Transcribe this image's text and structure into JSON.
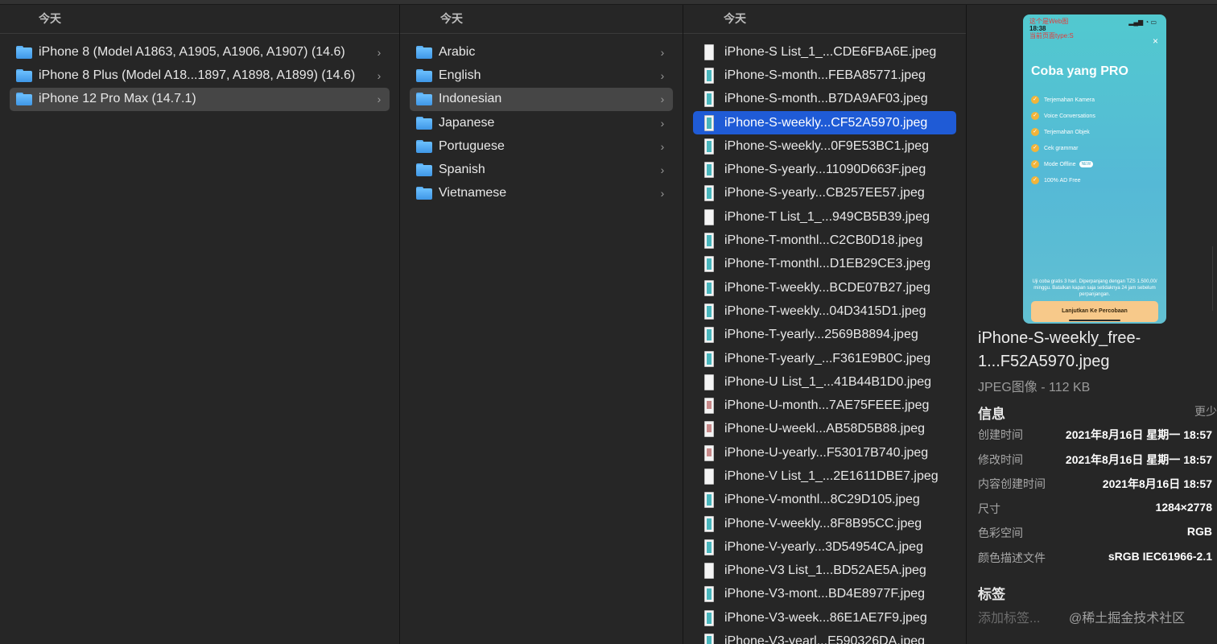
{
  "columns": {
    "col1": {
      "header": "今天",
      "items": [
        {
          "label": "iPhone 8 (Model A1863, A1905, A1906, A1907) (14.6)",
          "selected": false
        },
        {
          "label": "iPhone 8 Plus (Model A18...1897, A1898, A1899) (14.6)",
          "selected": false
        },
        {
          "label": "iPhone 12 Pro Max (14.7.1)",
          "selected": true
        }
      ]
    },
    "col2": {
      "header": "今天",
      "items": [
        {
          "label": "Arabic"
        },
        {
          "label": "English"
        },
        {
          "label": "Indonesian",
          "selected": true
        },
        {
          "label": "Japanese"
        },
        {
          "label": "Portuguese"
        },
        {
          "label": "Spanish"
        },
        {
          "label": "Vietnamese"
        }
      ]
    },
    "col3": {
      "header": "今天",
      "items": [
        {
          "label": "iPhone-S List_1_...CDE6FBA6E.jpeg",
          "thumb": "white"
        },
        {
          "label": "iPhone-S-month...FEBA85771.jpeg",
          "thumb": "teal"
        },
        {
          "label": "iPhone-S-month...B7DA9AF03.jpeg",
          "thumb": "teal"
        },
        {
          "label": "iPhone-S-weekly...CF52A5970.jpeg",
          "thumb": "teal",
          "selected": true
        },
        {
          "label": "iPhone-S-weekly...0F9E53BC1.jpeg",
          "thumb": "teal"
        },
        {
          "label": "iPhone-S-yearly...11090D663F.jpeg",
          "thumb": "teal"
        },
        {
          "label": "iPhone-S-yearly...CB257EE57.jpeg",
          "thumb": "teal"
        },
        {
          "label": "iPhone-T List_1_...949CB5B39.jpeg",
          "thumb": "white"
        },
        {
          "label": "iPhone-T-monthl...C2CB0D18.jpeg",
          "thumb": "teal"
        },
        {
          "label": "iPhone-T-monthl...D1EB29CE3.jpeg",
          "thumb": "teal"
        },
        {
          "label": "iPhone-T-weekly...BCDE07B27.jpeg",
          "thumb": "teal"
        },
        {
          "label": "iPhone-T-weekly...04D3415D1.jpeg",
          "thumb": "teal"
        },
        {
          "label": "iPhone-T-yearly...2569B8894.jpeg",
          "thumb": "teal"
        },
        {
          "label": "iPhone-T-yearly_...F361E9B0C.jpeg",
          "thumb": "teal"
        },
        {
          "label": "iPhone-U List_1_...41B44B1D0.jpeg",
          "thumb": "white"
        },
        {
          "label": "iPhone-U-month...7AE75FEEE.jpeg",
          "thumb": "mixed"
        },
        {
          "label": "iPhone-U-weekl...AB58D5B88.jpeg",
          "thumb": "mixed"
        },
        {
          "label": "iPhone-U-yearly...F53017B740.jpeg",
          "thumb": "mixed"
        },
        {
          "label": "iPhone-V List_1_...2E1611DBE7.jpeg",
          "thumb": "white"
        },
        {
          "label": "iPhone-V-monthl...8C29D105.jpeg",
          "thumb": "teal"
        },
        {
          "label": "iPhone-V-weekly...8F8B95CC.jpeg",
          "thumb": "teal"
        },
        {
          "label": "iPhone-V-yearly...3D54954CA.jpeg",
          "thumb": "teal"
        },
        {
          "label": "iPhone-V3 List_1...BD52AE5A.jpeg",
          "thumb": "white"
        },
        {
          "label": "iPhone-V3-mont...BD4E8977F.jpeg",
          "thumb": "teal"
        },
        {
          "label": "iPhone-V3-week...86E1AE7F9.jpeg",
          "thumb": "teal"
        },
        {
          "label": "iPhone-V3-yearl...E590326DA.jpeg",
          "thumb": "teal"
        }
      ]
    }
  },
  "preview": {
    "phone": {
      "status_line1": "这个是Web图",
      "time": "18:38",
      "status_line2": "当前页面type:S",
      "title": "Coba yang PRO",
      "features": [
        "Terjemahan Kamera",
        "Voice Conversations",
        "Terjemahan Objek",
        "Cek grammar",
        "Mode Offline",
        "100% AD Free"
      ],
      "new_badge": "NEW",
      "fine_print": "Uji coba gratis 3 hari. Diperpanjang dengan TZS 1.500,00/ minggu. Batalkan kapan saja setidaknya 24 jam sebelum perpanjangan.",
      "cta": "Lanjutkan Ke Percobaan",
      "close": "×"
    },
    "filename": "iPhone-S-weekly_free-1...F52A5970.jpeg",
    "filetype": "JPEG图像 - 112 KB",
    "info_title": "信息",
    "show_less": "更少",
    "info": [
      {
        "key": "创建时间",
        "value": "2021年8月16日 星期一 18:57"
      },
      {
        "key": "修改时间",
        "value": "2021年8月16日 星期一 18:57"
      },
      {
        "key": "内容创建时间",
        "value": "2021年8月16日 18:57"
      },
      {
        "key": "尺寸",
        "value": "1284×2778"
      },
      {
        "key": "色彩空间",
        "value": "RGB"
      },
      {
        "key": "颜色描述文件",
        "value": "sRGB IEC61966-2.1"
      }
    ],
    "tags_title": "标签",
    "add_tag": "添加标签..."
  },
  "watermark": "@稀土掘金技术社区",
  "chevron": "›"
}
